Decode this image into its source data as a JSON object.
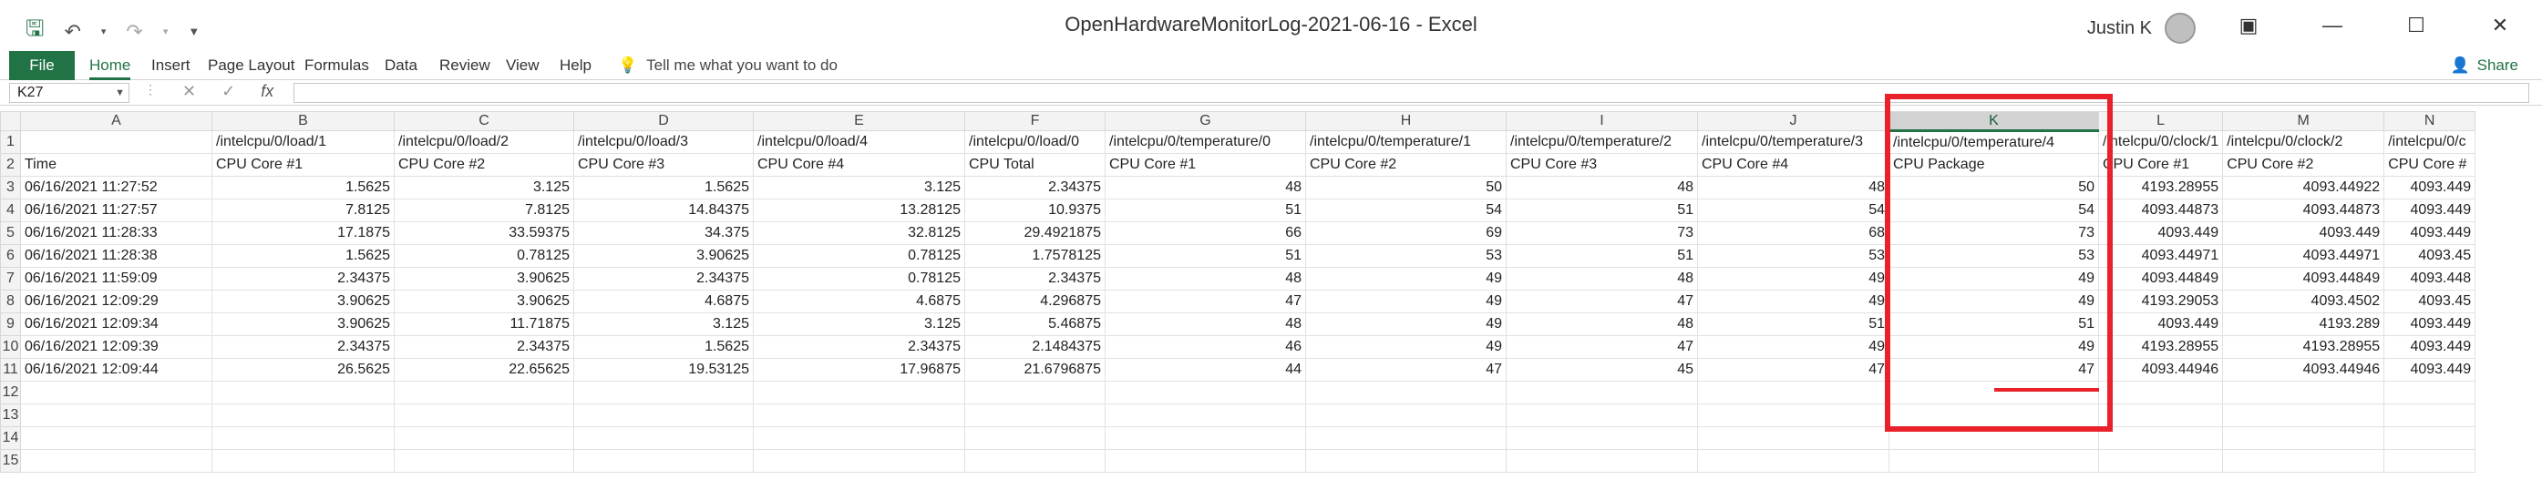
{
  "window": {
    "title": "OpenHardwareMonitorLog-2021-06-16  -  Excel",
    "user": "Justin K"
  },
  "ribbon": {
    "tabs": [
      "File",
      "Home",
      "Insert",
      "Page Layout",
      "Formulas",
      "Data",
      "Review",
      "View",
      "Help"
    ],
    "tell_me": "Tell me what you want to do",
    "share": "Share"
  },
  "formula_bar": {
    "name_box": "K27",
    "fx": "fx",
    "value": ""
  },
  "sheet": {
    "columns": [
      "A",
      "B",
      "C",
      "D",
      "E",
      "F",
      "G",
      "H",
      "I",
      "J",
      "K",
      "L",
      "M",
      "N"
    ],
    "selected_column": "K",
    "rows": [
      [
        "",
        "/intelcpu/0/load/1",
        "/intelcpu/0/load/2",
        "/intelcpu/0/load/3",
        "/intelcpu/0/load/4",
        "/intelcpu/0/load/0",
        "/intelcpu/0/temperature/0",
        "/intelcpu/0/temperature/1",
        "/intelcpu/0/temperature/2",
        "/intelcpu/0/temperature/3",
        "/intelcpu/0/temperature/4",
        "/intelcpu/0/clock/1",
        "/intelcpu/0/clock/2",
        "/intelcpu/0/c"
      ],
      [
        "Time",
        "CPU Core #1",
        "CPU Core #2",
        "CPU Core #3",
        "CPU Core #4",
        "CPU Total",
        "CPU Core #1",
        "CPU Core #2",
        "CPU Core #3",
        "CPU Core #4",
        "CPU Package",
        "CPU Core #1",
        "CPU Core #2",
        "CPU Core #"
      ],
      [
        "06/16/2021 11:27:52",
        "1.5625",
        "3.125",
        "1.5625",
        "3.125",
        "2.34375",
        "48",
        "50",
        "48",
        "48",
        "50",
        "4193.28955",
        "4093.44922",
        "4093.449"
      ],
      [
        "06/16/2021 11:27:57",
        "7.8125",
        "7.8125",
        "14.84375",
        "13.28125",
        "10.9375",
        "51",
        "54",
        "51",
        "54",
        "54",
        "4093.44873",
        "4093.44873",
        "4093.449"
      ],
      [
        "06/16/2021 11:28:33",
        "17.1875",
        "33.59375",
        "34.375",
        "32.8125",
        "29.4921875",
        "66",
        "69",
        "73",
        "68",
        "73",
        "4093.449",
        "4093.449",
        "4093.449"
      ],
      [
        "06/16/2021 11:28:38",
        "1.5625",
        "0.78125",
        "3.90625",
        "0.78125",
        "1.7578125",
        "51",
        "53",
        "51",
        "53",
        "53",
        "4093.44971",
        "4093.44971",
        "4093.45"
      ],
      [
        "06/16/2021 11:59:09",
        "2.34375",
        "3.90625",
        "2.34375",
        "0.78125",
        "2.34375",
        "48",
        "49",
        "48",
        "49",
        "49",
        "4093.44849",
        "4093.44849",
        "4093.448"
      ],
      [
        "06/16/2021 12:09:29",
        "3.90625",
        "3.90625",
        "4.6875",
        "4.6875",
        "4.296875",
        "47",
        "49",
        "47",
        "49",
        "49",
        "4193.29053",
        "4093.4502",
        "4093.45"
      ],
      [
        "06/16/2021 12:09:34",
        "3.90625",
        "11.71875",
        "3.125",
        "3.125",
        "5.46875",
        "48",
        "49",
        "48",
        "51",
        "51",
        "4093.449",
        "4193.289",
        "4093.449"
      ],
      [
        "06/16/2021 12:09:39",
        "2.34375",
        "2.34375",
        "1.5625",
        "2.34375",
        "2.1484375",
        "46",
        "49",
        "47",
        "49",
        "49",
        "4193.28955",
        "4193.28955",
        "4093.449"
      ],
      [
        "06/16/2021 12:09:44",
        "26.5625",
        "22.65625",
        "19.53125",
        "17.96875",
        "21.6796875",
        "44",
        "47",
        "45",
        "47",
        "47",
        "4093.44946",
        "4093.44946",
        "4093.449"
      ],
      [
        "",
        "",
        "",
        "",
        "",
        "",
        "",
        "",
        "",
        "",
        "",
        "",
        "",
        ""
      ],
      [
        "",
        "",
        "",
        "",
        "",
        "",
        "",
        "",
        "",
        "",
        "",
        "",
        "",
        ""
      ],
      [
        "",
        "",
        "",
        "",
        "",
        "",
        "",
        "",
        "",
        "",
        "",
        "",
        "",
        ""
      ],
      [
        "",
        "",
        "",
        "",
        "",
        "",
        "",
        "",
        "",
        "",
        "",
        "",
        "",
        ""
      ]
    ]
  },
  "highlight_color": "#e8212a",
  "accent": "#217346"
}
